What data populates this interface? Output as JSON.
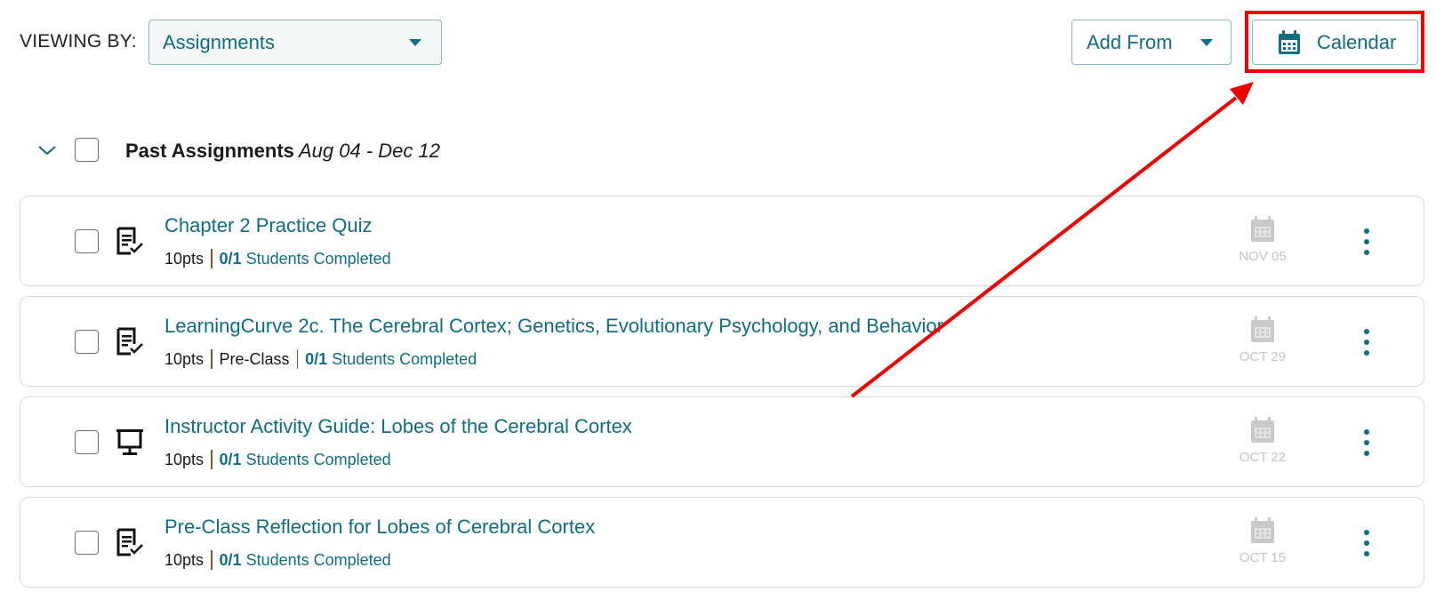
{
  "toolbar": {
    "viewing_label": "VIEWING BY:",
    "view_select": {
      "selected": "Assignments"
    },
    "add_from_label": "Add From",
    "calendar_label": "Calendar"
  },
  "section": {
    "title": "Past Assignments",
    "date_range": "Aug 04 - Dec 12",
    "expanded": true
  },
  "assignments": [
    {
      "title": "Chapter 2 Practice Quiz",
      "type_icon": "quiz-icon",
      "points": "10pts",
      "category": null,
      "completed_fraction": "0/1",
      "completed_label": "Students Completed",
      "due_date": "NOV 05"
    },
    {
      "title": "LearningCurve 2c. The Cerebral Cortex; Genetics, Evolutionary Psychology, and Behavior",
      "type_icon": "quiz-icon",
      "points": "10pts",
      "category": "Pre-Class",
      "completed_fraction": "0/1",
      "completed_label": "Students Completed",
      "due_date": "OCT 29"
    },
    {
      "title": "Instructor Activity Guide: Lobes of the Cerebral Cortex",
      "type_icon": "presentation-icon",
      "points": "10pts",
      "category": null,
      "completed_fraction": "0/1",
      "completed_label": "Students Completed",
      "due_date": "OCT 22"
    },
    {
      "title": "Pre-Class Reflection for Lobes of Cerebral Cortex",
      "type_icon": "quiz-icon",
      "points": "10pts",
      "category": null,
      "completed_fraction": "0/1",
      "completed_label": "Students Completed",
      "due_date": "OCT 15"
    }
  ],
  "colors": {
    "accent": "#0f6e84",
    "muted_date": "#c4c4c4",
    "annotation": "#ee0000"
  },
  "annotation": {
    "type": "arrow-and-box",
    "target": "calendar-button"
  }
}
